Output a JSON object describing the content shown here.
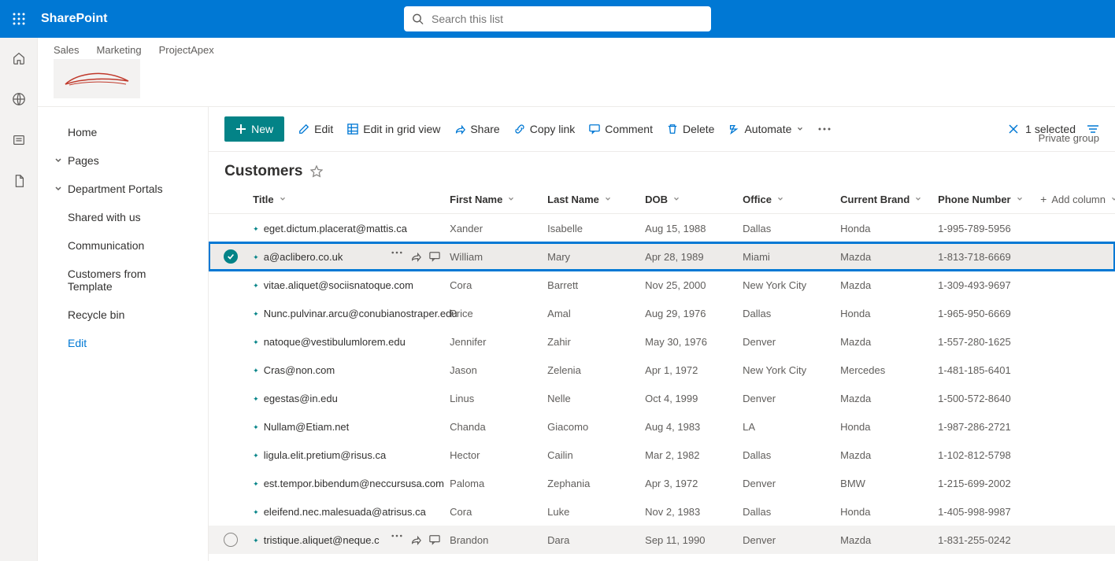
{
  "suite": {
    "brand": "SharePoint",
    "search_placeholder": "Search this list"
  },
  "site": {
    "tabs": [
      "Sales",
      "Marketing",
      "ProjectApex"
    ],
    "group_label": "Private group"
  },
  "nav": {
    "home": "Home",
    "pages": "Pages",
    "dept": "Department Portals",
    "shared": "Shared with us",
    "comm": "Communication",
    "cust_tmpl": "Customers from Template",
    "recycle": "Recycle bin",
    "edit": "Edit"
  },
  "cmd": {
    "new": "New",
    "edit": "Edit",
    "grid": "Edit in grid view",
    "share": "Share",
    "copy": "Copy link",
    "comment": "Comment",
    "delete": "Delete",
    "automate": "Automate",
    "selected": "1 selected"
  },
  "list": {
    "title": "Customers"
  },
  "columns": {
    "title": "Title",
    "first": "First Name",
    "last": "Last Name",
    "dob": "DOB",
    "office": "Office",
    "brand": "Current Brand",
    "phone": "Phone Number",
    "add": "Add column"
  },
  "rows": [
    {
      "title": "eget.dictum.placerat@mattis.ca",
      "first": "Xander",
      "last": "Isabelle",
      "dob": "Aug 15, 1988",
      "office": "Dallas",
      "brand": "Honda",
      "phone": "1-995-789-5956"
    },
    {
      "title": "a@aclibero.co.uk",
      "first": "William",
      "last": "Mary",
      "dob": "Apr 28, 1989",
      "office": "Miami",
      "brand": "Mazda",
      "phone": "1-813-718-6669"
    },
    {
      "title": "vitae.aliquet@sociisnatoque.com",
      "first": "Cora",
      "last": "Barrett",
      "dob": "Nov 25, 2000",
      "office": "New York City",
      "brand": "Mazda",
      "phone": "1-309-493-9697"
    },
    {
      "title": "Nunc.pulvinar.arcu@conubianostraper.edu",
      "first": "Price",
      "last": "Amal",
      "dob": "Aug 29, 1976",
      "office": "Dallas",
      "brand": "Honda",
      "phone": "1-965-950-6669"
    },
    {
      "title": "natoque@vestibulumlorem.edu",
      "first": "Jennifer",
      "last": "Zahir",
      "dob": "May 30, 1976",
      "office": "Denver",
      "brand": "Mazda",
      "phone": "1-557-280-1625"
    },
    {
      "title": "Cras@non.com",
      "first": "Jason",
      "last": "Zelenia",
      "dob": "Apr 1, 1972",
      "office": "New York City",
      "brand": "Mercedes",
      "phone": "1-481-185-6401"
    },
    {
      "title": "egestas@in.edu",
      "first": "Linus",
      "last": "Nelle",
      "dob": "Oct 4, 1999",
      "office": "Denver",
      "brand": "Mazda",
      "phone": "1-500-572-8640"
    },
    {
      "title": "Nullam@Etiam.net",
      "first": "Chanda",
      "last": "Giacomo",
      "dob": "Aug 4, 1983",
      "office": "LA",
      "brand": "Honda",
      "phone": "1-987-286-2721"
    },
    {
      "title": "ligula.elit.pretium@risus.ca",
      "first": "Hector",
      "last": "Cailin",
      "dob": "Mar 2, 1982",
      "office": "Dallas",
      "brand": "Mazda",
      "phone": "1-102-812-5798"
    },
    {
      "title": "est.tempor.bibendum@neccursusa.com",
      "first": "Paloma",
      "last": "Zephania",
      "dob": "Apr 3, 1972",
      "office": "Denver",
      "brand": "BMW",
      "phone": "1-215-699-2002"
    },
    {
      "title": "eleifend.nec.malesuada@atrisus.ca",
      "first": "Cora",
      "last": "Luke",
      "dob": "Nov 2, 1983",
      "office": "Dallas",
      "brand": "Honda",
      "phone": "1-405-998-9987"
    },
    {
      "title": "tristique.aliquet@neque.c",
      "first": "Brandon",
      "last": "Dara",
      "dob": "Sep 11, 1990",
      "office": "Denver",
      "brand": "Mazda",
      "phone": "1-831-255-0242"
    }
  ]
}
